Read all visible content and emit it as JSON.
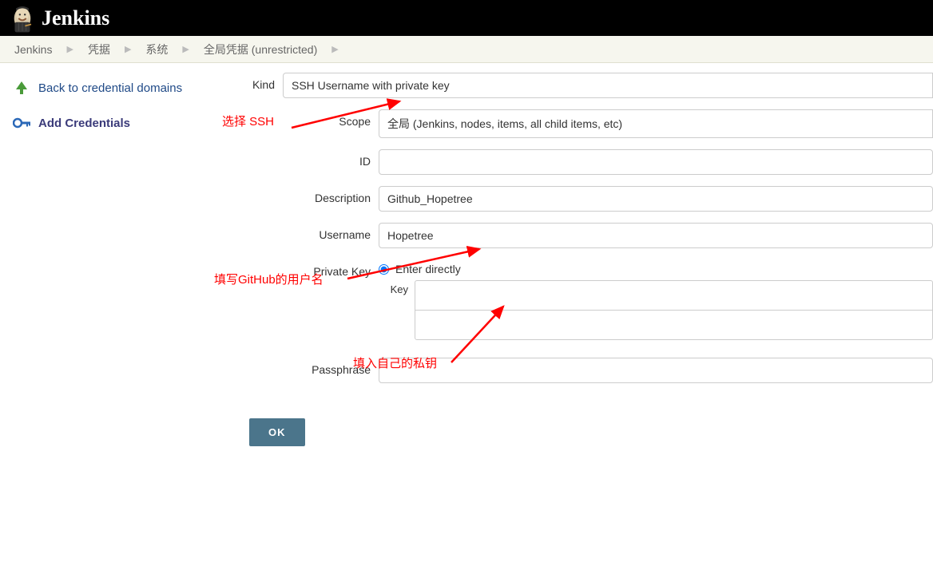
{
  "header": {
    "app_name": "Jenkins"
  },
  "breadcrumb": {
    "items": [
      "Jenkins",
      "凭据",
      "系统",
      "全局凭据 (unrestricted)"
    ]
  },
  "sidebar": {
    "back_link": "Back to credential domains",
    "add_link": "Add Credentials"
  },
  "form": {
    "kind": {
      "label": "Kind",
      "value": "SSH Username with private key"
    },
    "scope": {
      "label": "Scope",
      "value": "全局 (Jenkins, nodes, items, all child items, etc)"
    },
    "id": {
      "label": "ID",
      "value": ""
    },
    "description": {
      "label": "Description",
      "value": "Github_Hopetree"
    },
    "username": {
      "label": "Username",
      "value": "Hopetree"
    },
    "private_key": {
      "label": "Private Key",
      "option": "Enter directly",
      "sub_label": "Key"
    },
    "passphrase": {
      "label": "Passphrase",
      "value": ""
    },
    "ok": "OK"
  },
  "annotations": {
    "ssh": "选择 SSH",
    "username": "填写GitHub的用户名",
    "privkey": "填入自己的私钥"
  }
}
